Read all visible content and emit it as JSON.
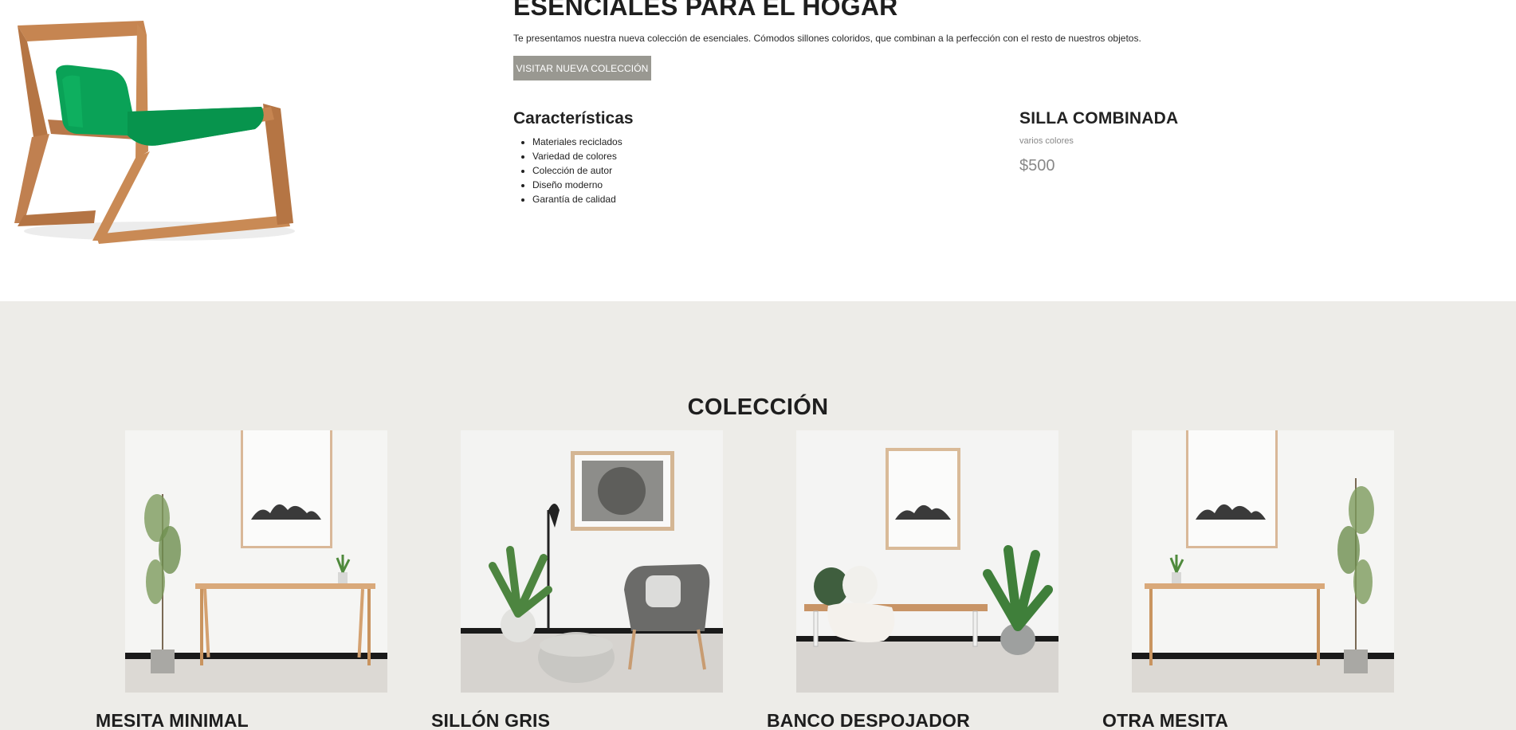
{
  "hero": {
    "title": "ESENCIALES PARA EL HOGAR",
    "description": "Te presentamos nuestra nueva colección de esenciales. Cómodos sillones coloridos, que combinan a la perfección con el resto de nuestros objetos.",
    "button_label": "VISITAR NUEVA COLECCIÓN",
    "image_icon": "green-chair-image"
  },
  "features": {
    "title": "Características",
    "items": [
      "Materiales reciclados",
      "Variedad de colores",
      "Colección de autor",
      "Diseño moderno",
      "Garantía de calidad"
    ]
  },
  "product": {
    "name": "SILLA COMBINADA",
    "variant": "varios colores",
    "price": "$500"
  },
  "collection": {
    "title": "COLECCIÓN",
    "items": [
      {
        "name": "MESITA MINIMAL",
        "image": "console-table-plant-image"
      },
      {
        "name": "SILLÓN GRIS",
        "image": "grey-armchair-image"
      },
      {
        "name": "BANCO DESPOJADOR",
        "image": "bench-image"
      },
      {
        "name": "OTRA MESITA",
        "image": "console-table-mirror-image"
      }
    ]
  },
  "colors": {
    "button_bg": "#999891",
    "collection_bg": "#edece8",
    "chair_green": "#0aa257",
    "wood": "#c98a55"
  }
}
